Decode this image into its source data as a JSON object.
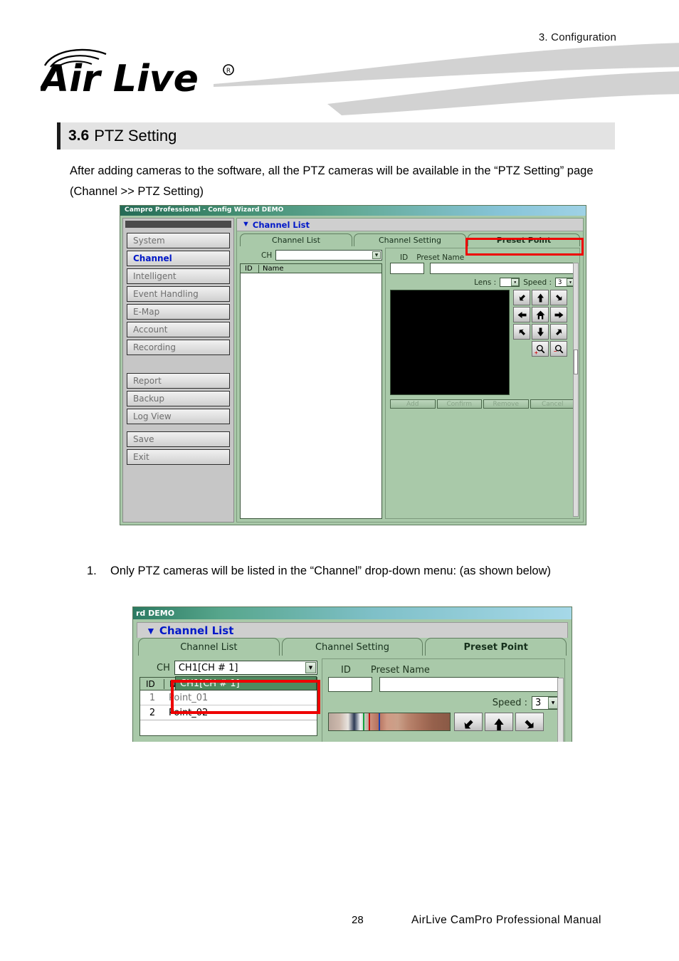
{
  "header": {
    "chapter_ref": "3.  Configuration",
    "logo_text": "Air Live",
    "logo_mark": "registered-trademark"
  },
  "section": {
    "number": "3.6",
    "title": "PTZ Setting"
  },
  "intro_paragraph": "After adding cameras to the software, all the PTZ cameras will be available in the “PTZ Setting” page (Channel >> PTZ Setting)",
  "list_item": {
    "number": "1.",
    "text": "Only PTZ cameras will be listed in the “Channel” drop-down menu: (as shown below)"
  },
  "footer": {
    "page_number": "28",
    "manual_title": "AirLive  CamPro  Professional  Manual"
  },
  "screenshot1": {
    "window_title": "Campro Professional - Config Wizard DEMO",
    "sidebar": {
      "items": [
        {
          "label": "System",
          "active": false
        },
        {
          "label": "Channel",
          "active": true
        },
        {
          "label": "Intelligent",
          "active": false
        },
        {
          "label": "Event Handling",
          "active": false
        },
        {
          "label": "E-Map",
          "active": false
        },
        {
          "label": "Account",
          "active": false
        },
        {
          "label": "Recording",
          "active": false
        },
        {
          "label": "Report",
          "active": false
        },
        {
          "label": "Backup",
          "active": false
        },
        {
          "label": "Log View",
          "active": false
        },
        {
          "label": "Save",
          "active": false
        },
        {
          "label": "Exit",
          "active": false
        }
      ]
    },
    "panel_header": "Channel List",
    "tabs": [
      {
        "label": "Channel List",
        "selected": false
      },
      {
        "label": "Channel Setting",
        "selected": false
      },
      {
        "label": "Preset Point",
        "selected": true
      }
    ],
    "channel_field": {
      "label": "CH",
      "value": "",
      "placeholder": ""
    },
    "grid": {
      "columns": [
        "ID",
        "Name"
      ],
      "rows": []
    },
    "preset": {
      "id_label": "ID",
      "name_label": "Preset Name",
      "id_value": "",
      "name_value": "",
      "lens_label": "Lens :",
      "lens_value": "",
      "speed_label": "Speed :",
      "speed_value": "3"
    },
    "ptz_buttons": [
      "arrow-up-left-icon",
      "arrow-up-icon",
      "arrow-up-right-icon",
      "arrow-left-icon",
      "home-icon",
      "arrow-right-icon",
      "arrow-down-left-icon",
      "arrow-down-icon",
      "arrow-down-right-icon"
    ],
    "zoom_buttons": [
      "zoom-in-icon",
      "zoom-out-icon"
    ],
    "action_buttons": [
      "Add",
      "Confirm",
      "Remove",
      "Cancel"
    ],
    "highlight_color": "#ee0000"
  },
  "screenshot2": {
    "window_title": "rd DEMO",
    "panel_header": "Channel List",
    "tabs": [
      {
        "label": "Channel List",
        "selected": false
      },
      {
        "label": "Channel Setting",
        "selected": false
      },
      {
        "label": "Preset Point",
        "selected": true
      }
    ],
    "channel_field": {
      "label": "CH",
      "value": "CH1[CH # 1]"
    },
    "dropdown_options": [
      "CH1[CH # 1]"
    ],
    "grid": {
      "columns": [
        "ID",
        "Name"
      ],
      "rows": [
        {
          "id": "1",
          "name": "Point_01"
        },
        {
          "id": "2",
          "name": "Point_02"
        }
      ]
    },
    "preset": {
      "id_label": "ID",
      "name_label": "Preset Name",
      "id_value": "",
      "name_value": "",
      "speed_label": "Speed :",
      "speed_value": "3"
    },
    "highlight_color": "#ee0000"
  },
  "colors": {
    "panel_green": "#a9c9a9",
    "heading_band": "#e3e3e3",
    "accent_blue": "#0018c8",
    "highlight_red": "#ee0000",
    "swoosh_gray": "#d2d2d2"
  }
}
